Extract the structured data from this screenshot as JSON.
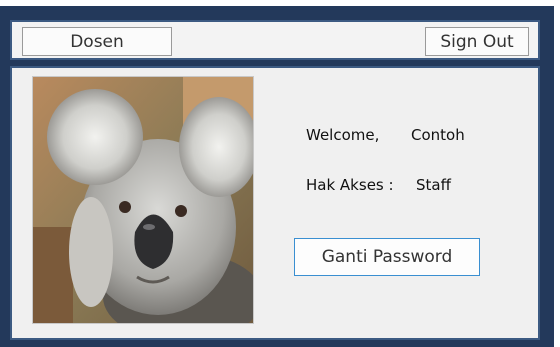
{
  "toolbar": {
    "dosen_label": "Dosen",
    "signout_label": "Sign Out"
  },
  "profile": {
    "photo_icon": "koala-photo",
    "welcome_label": "Welcome,",
    "user_name": "Contoh",
    "access_label": "Hak Akses :",
    "access_value": "Staff"
  },
  "actions": {
    "change_password_label": "Ganti Password"
  },
  "colors": {
    "frame": "#23395b",
    "panel_border": "#3c5a82",
    "button_focus_border": "#3a8fd1"
  }
}
